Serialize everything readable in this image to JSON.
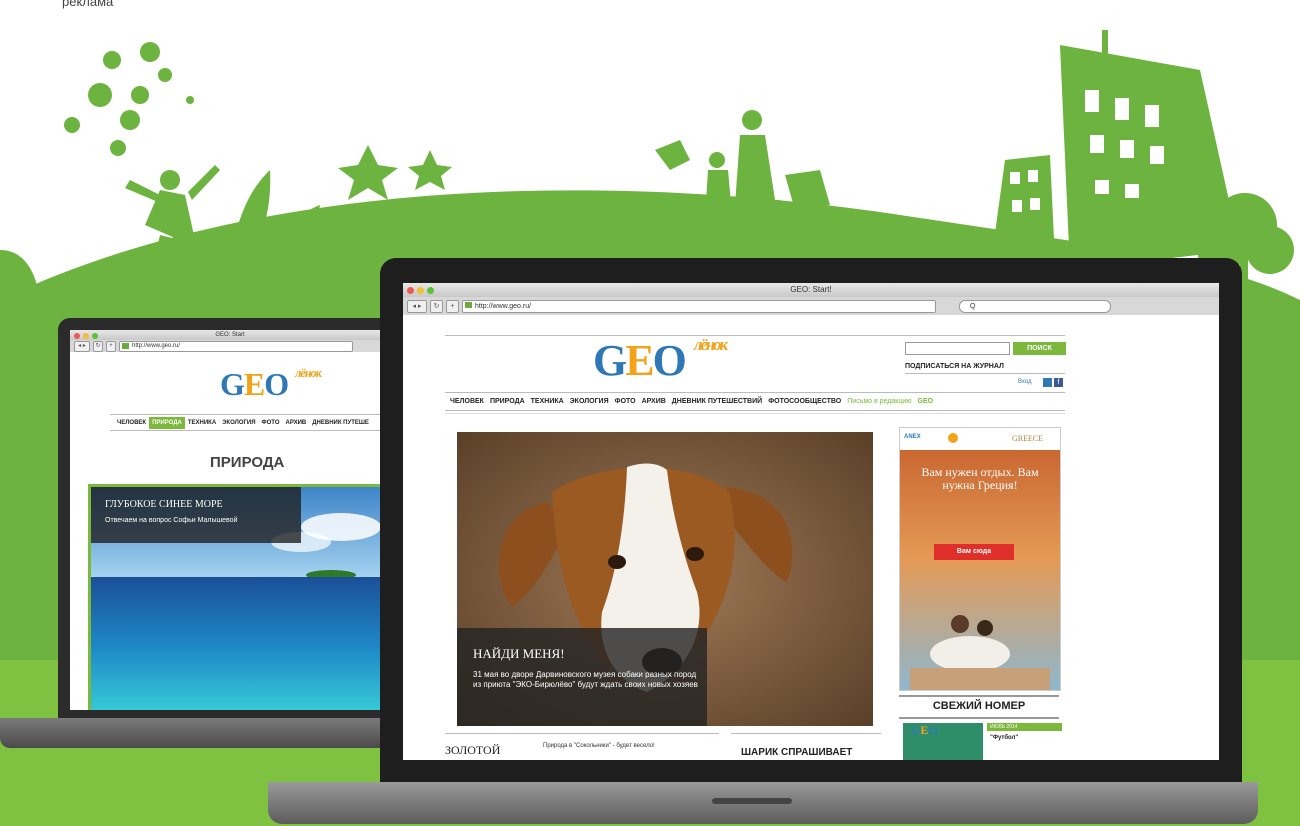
{
  "caption": "реклама",
  "colors": {
    "brand_green": "#7bb83c",
    "landscape_green": "#6cb33f",
    "logo_blue": "#2f78b7",
    "logo_orange": "#f2a31a"
  },
  "back_browser": {
    "window_title": "GEO: Start",
    "url": "http://www.geo.ru/",
    "logo": {
      "main": "GEO",
      "sub": "лёнок"
    },
    "nav": [
      "ЧЕЛОВЕК",
      "ПРИРОДА",
      "ТЕХНИКА",
      "ЭКОЛОГИЯ",
      "ФОТО",
      "АРХИВ",
      "ДНЕВНИК ПУТЕШЕ"
    ],
    "active_nav": "ПРИРОДА",
    "section_title": "ПРИРОДА",
    "feature": {
      "title": "ГЛУБОКОЕ СИНЕЕ МОРЕ",
      "text": "Отвечаем на вопрос Софьи Малышевой"
    }
  },
  "front_browser": {
    "window_title": "GEO: Start!",
    "url": "http://www.geo.ru/",
    "search_hint": "Q",
    "logo": {
      "main": "GEO",
      "sub": "лёнок"
    },
    "search_button": "ПОИСК",
    "subscribe": "ПОДПИСАТЬСЯ НА ЖУРНАЛ",
    "login": "Вход",
    "nav": [
      "ЧЕЛОВЕК",
      "ПРИРОДА",
      "ТЕХНИКА",
      "ЭКОЛОГИЯ",
      "ФОТО",
      "АРХИВ",
      "ДНЕВНИК ПУТЕШЕСТВИЙ",
      "ФОТОСООБЩЕСТВО"
    ],
    "nav_extra": [
      "Письмо в редакцию",
      "GEO"
    ],
    "hero": {
      "title": "НАЙДИ МЕНЯ!",
      "text": "31 мая во дворе Дарвиновского музея собаки разных пород из приюта \"ЭКО-Бирюлёво\" будут ждать своих новых хозяев"
    },
    "ad": {
      "brands": [
        "ANEX",
        "GREECE"
      ],
      "text": "Вам нужен отдых. Вам нужна Греция!",
      "button": "Вам сюда"
    },
    "fresh_issue": {
      "title": "СВЕЖИЙ НОМЕР",
      "issue": "ИЮЛЬ 2014",
      "topic": "\"Футбол\""
    },
    "bottom_left": "ЗОЛОТОЙ",
    "bottom_mid": "Природа в \"Сокольники\" - будет весело!",
    "bottom_right": "ШАРИК СПРАШИВАЕТ"
  }
}
